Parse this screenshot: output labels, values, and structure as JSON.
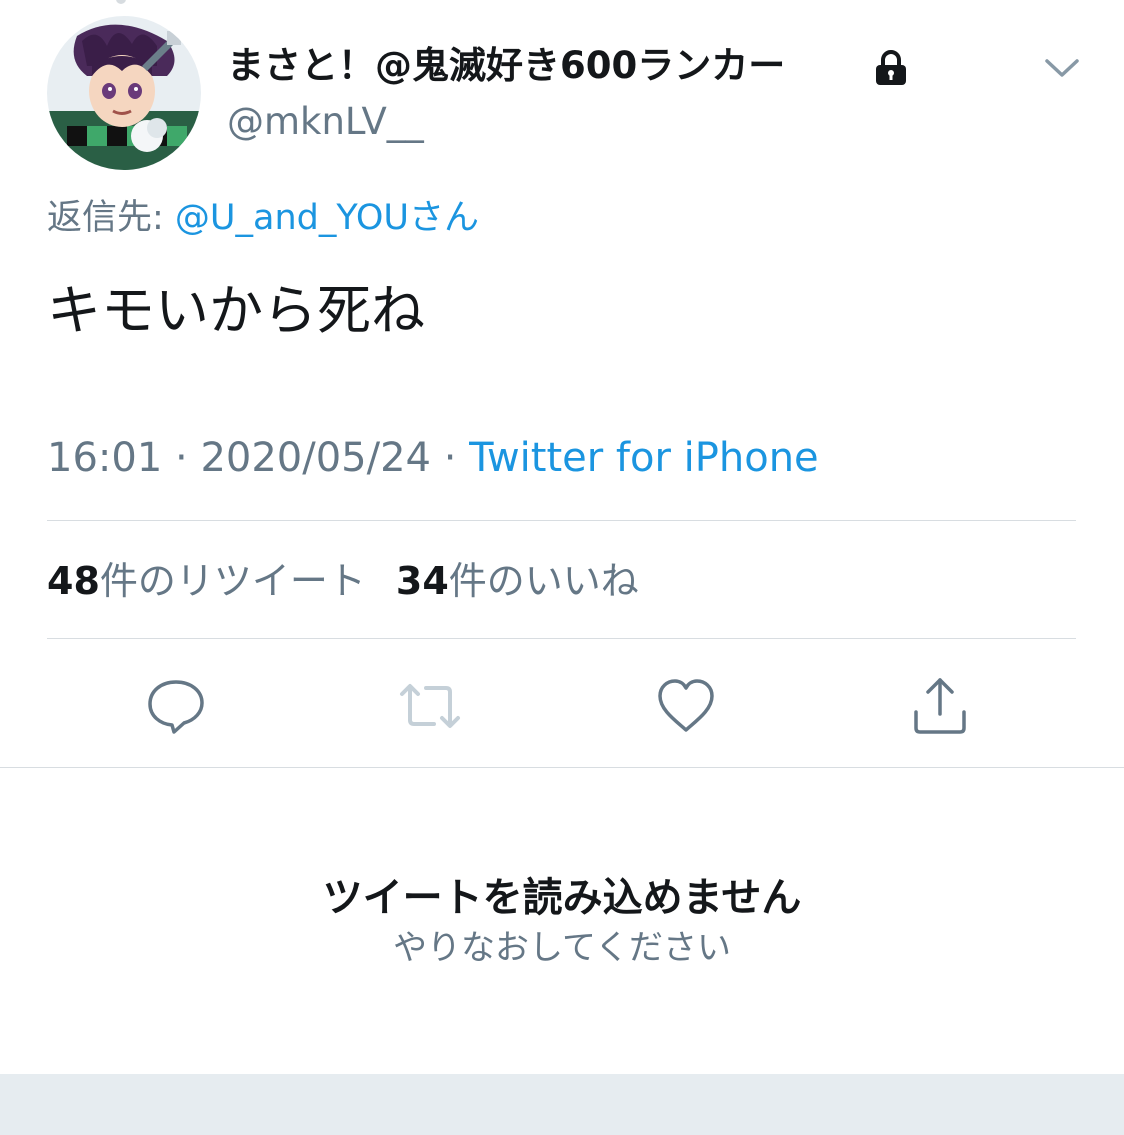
{
  "tweet": {
    "display_name": "まさと！@鬼滅好き600ランカー",
    "handle": "@mknLV__",
    "reply_prefix": "返信先: ",
    "reply_user": "@U_and_YOUさん",
    "text": "キモいから死ね",
    "time": "16:01",
    "date": "2020/05/24",
    "separator": " · ",
    "source": "Twitter for iPhone"
  },
  "stats": {
    "retweet_count": "48",
    "retweet_label": "件のリツイート",
    "like_count": "34",
    "like_label": "件のいいね"
  },
  "actions": {
    "reply_icon": "reply-bubble-icon",
    "retweet_icon": "retweet-icon",
    "like_icon": "heart-icon",
    "share_icon": "share-icon"
  },
  "error": {
    "title": "ツイートを読み込めません",
    "subtitle": "やりなおしてください"
  },
  "colors": {
    "text_primary": "#14171a",
    "text_secondary": "#657786",
    "link": "#1b95e0",
    "divider": "#d8dde1",
    "bottom_band": "#e6ecf0"
  }
}
